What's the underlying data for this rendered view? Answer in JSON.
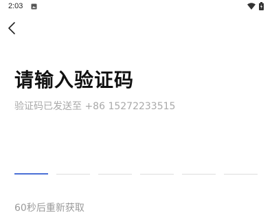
{
  "status_bar": {
    "time": "2:03",
    "icons": [
      "notification-icon",
      "wifi-icon",
      "battery-icon"
    ]
  },
  "header": {
    "back_icon": "chevron-left-icon"
  },
  "verify": {
    "title": "请输入验证码",
    "subtitle": "验证码已发送至 +86 15272233515",
    "code_length": 6,
    "code_value": "",
    "active_slot_color": "#4a6fd6",
    "resend_text": "60秒后重新获取"
  }
}
